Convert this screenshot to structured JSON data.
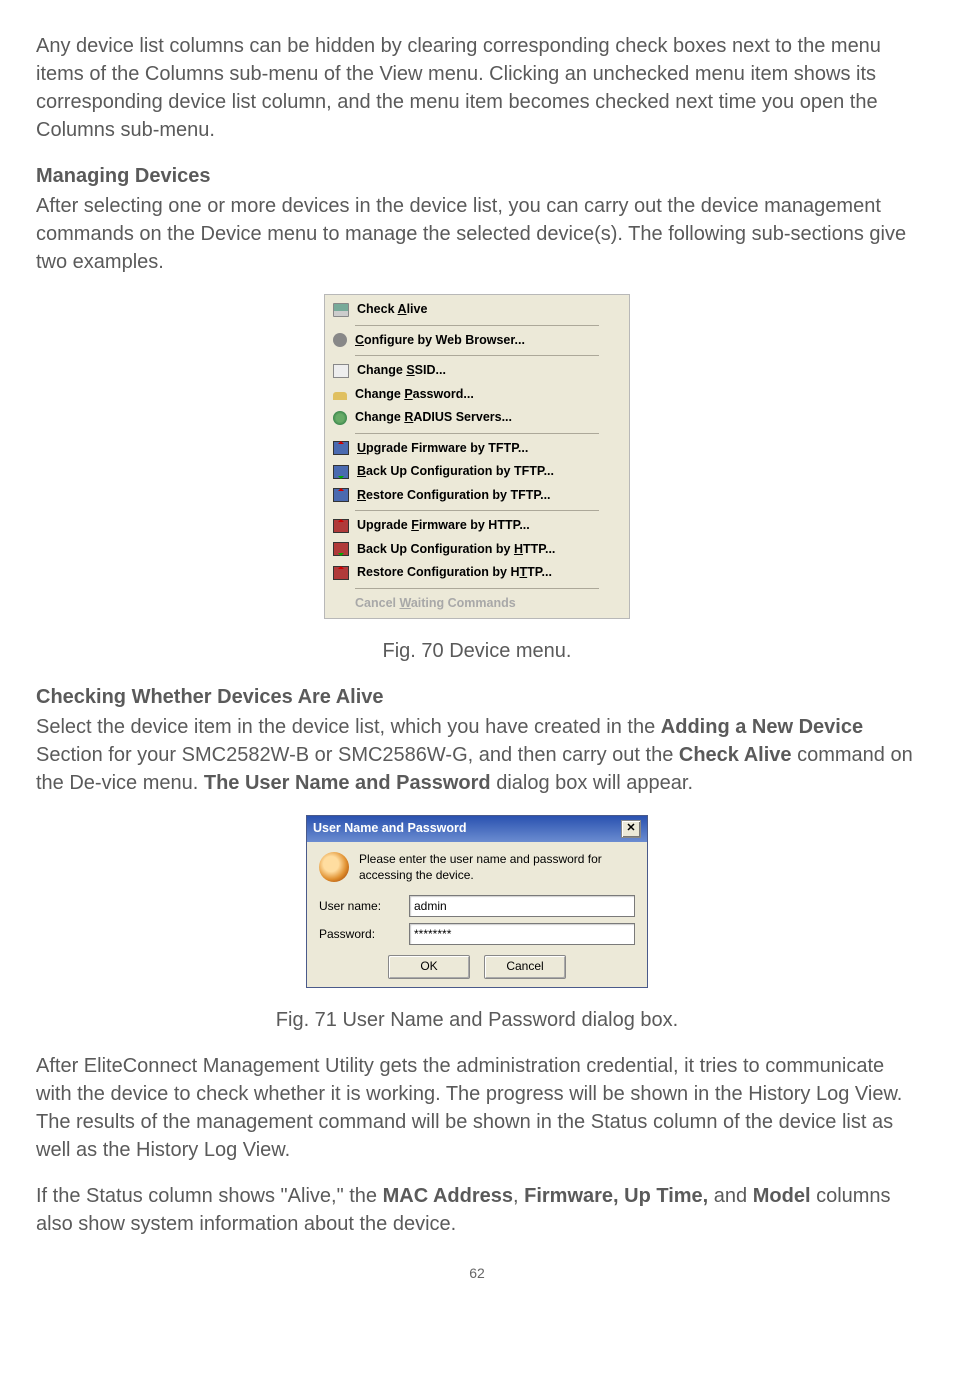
{
  "intro_paragraph": "Any device list columns can be hidden by clearing corresponding check boxes next to the menu items of the Columns sub-menu of the View menu. Clicking an unchecked menu item shows its corresponding device list column, and the menu item becomes checked next time you open the Columns sub-menu.",
  "managing_heading": "Managing Devices",
  "managing_paragraph": "After selecting one or more devices in the device list, you can carry out the device management commands on the Device menu to manage the selected device(s). The following sub-sections give two examples.",
  "device_menu": {
    "items": [
      {
        "u": "A",
        "pre": "Check ",
        "post": "live"
      },
      {
        "u": "C",
        "pre": "",
        "post": "onfigure by Web Browser..."
      },
      {
        "u": "S",
        "pre": "Change ",
        "post": "SID..."
      },
      {
        "u": "P",
        "pre": "Change ",
        "post": "assword..."
      },
      {
        "u": "R",
        "pre": "Change ",
        "post": "ADIUS Servers..."
      },
      {
        "u": "U",
        "pre": "",
        "post": "pgrade Firmware by TFTP..."
      },
      {
        "u": "B",
        "pre": "",
        "post": "ack Up Configuration by TFTP..."
      },
      {
        "u": "R",
        "pre": "",
        "post": "estore Configuration by TFTP..."
      },
      {
        "u": "F",
        "pre": "Upgrade ",
        "post": "irmware by HTTP..."
      },
      {
        "u": "H",
        "pre": "Back Up Configuration by ",
        "post": "TTP..."
      },
      {
        "u": "T",
        "pre": "Restore Configuration by H",
        "post": "TP..."
      },
      {
        "u": "W",
        "pre": "Cancel ",
        "post": "aiting Commands"
      }
    ]
  },
  "fig70_caption": "Fig. 70 Device menu.",
  "checking_heading": "Checking Whether Devices Are Alive",
  "checking_para": {
    "t1": "Select the device item in the device list, which you have created in the ",
    "b1": "Adding a New Device",
    "t2": " Section for your SMC2582W-B or SMC2586W-G, and then carry out the ",
    "b2": "Check Alive",
    "t3": " command on the De-vice menu. ",
    "b3": "The User Name and Password",
    "t4": " dialog box will appear."
  },
  "dialog": {
    "title": "User Name and Password",
    "message": "Please enter the user name and password for accessing the device.",
    "username_label": "User name:",
    "username_value": "admin",
    "password_label": "Password:",
    "password_value": "********",
    "ok": "OK",
    "cancel": "Cancel"
  },
  "fig71_caption": "Fig. 71 User Name and Password dialog box.",
  "after_para": "After EliteConnect Management Utility gets the administration credential, it tries to communicate with the device to check whether it is working. The progress will be shown in the History Log View. The results of the management command will be shown in the Status column of the device list as well as the History Log View.",
  "status_para": {
    "t1": "If the Status column shows \"Alive,\" the ",
    "b1": "MAC Address",
    "t2": ", ",
    "b2": "Firmware, Up Time,",
    "t3": " and ",
    "b3": "Model",
    "t4": " columns also show system information about the device."
  },
  "page_number": "62"
}
